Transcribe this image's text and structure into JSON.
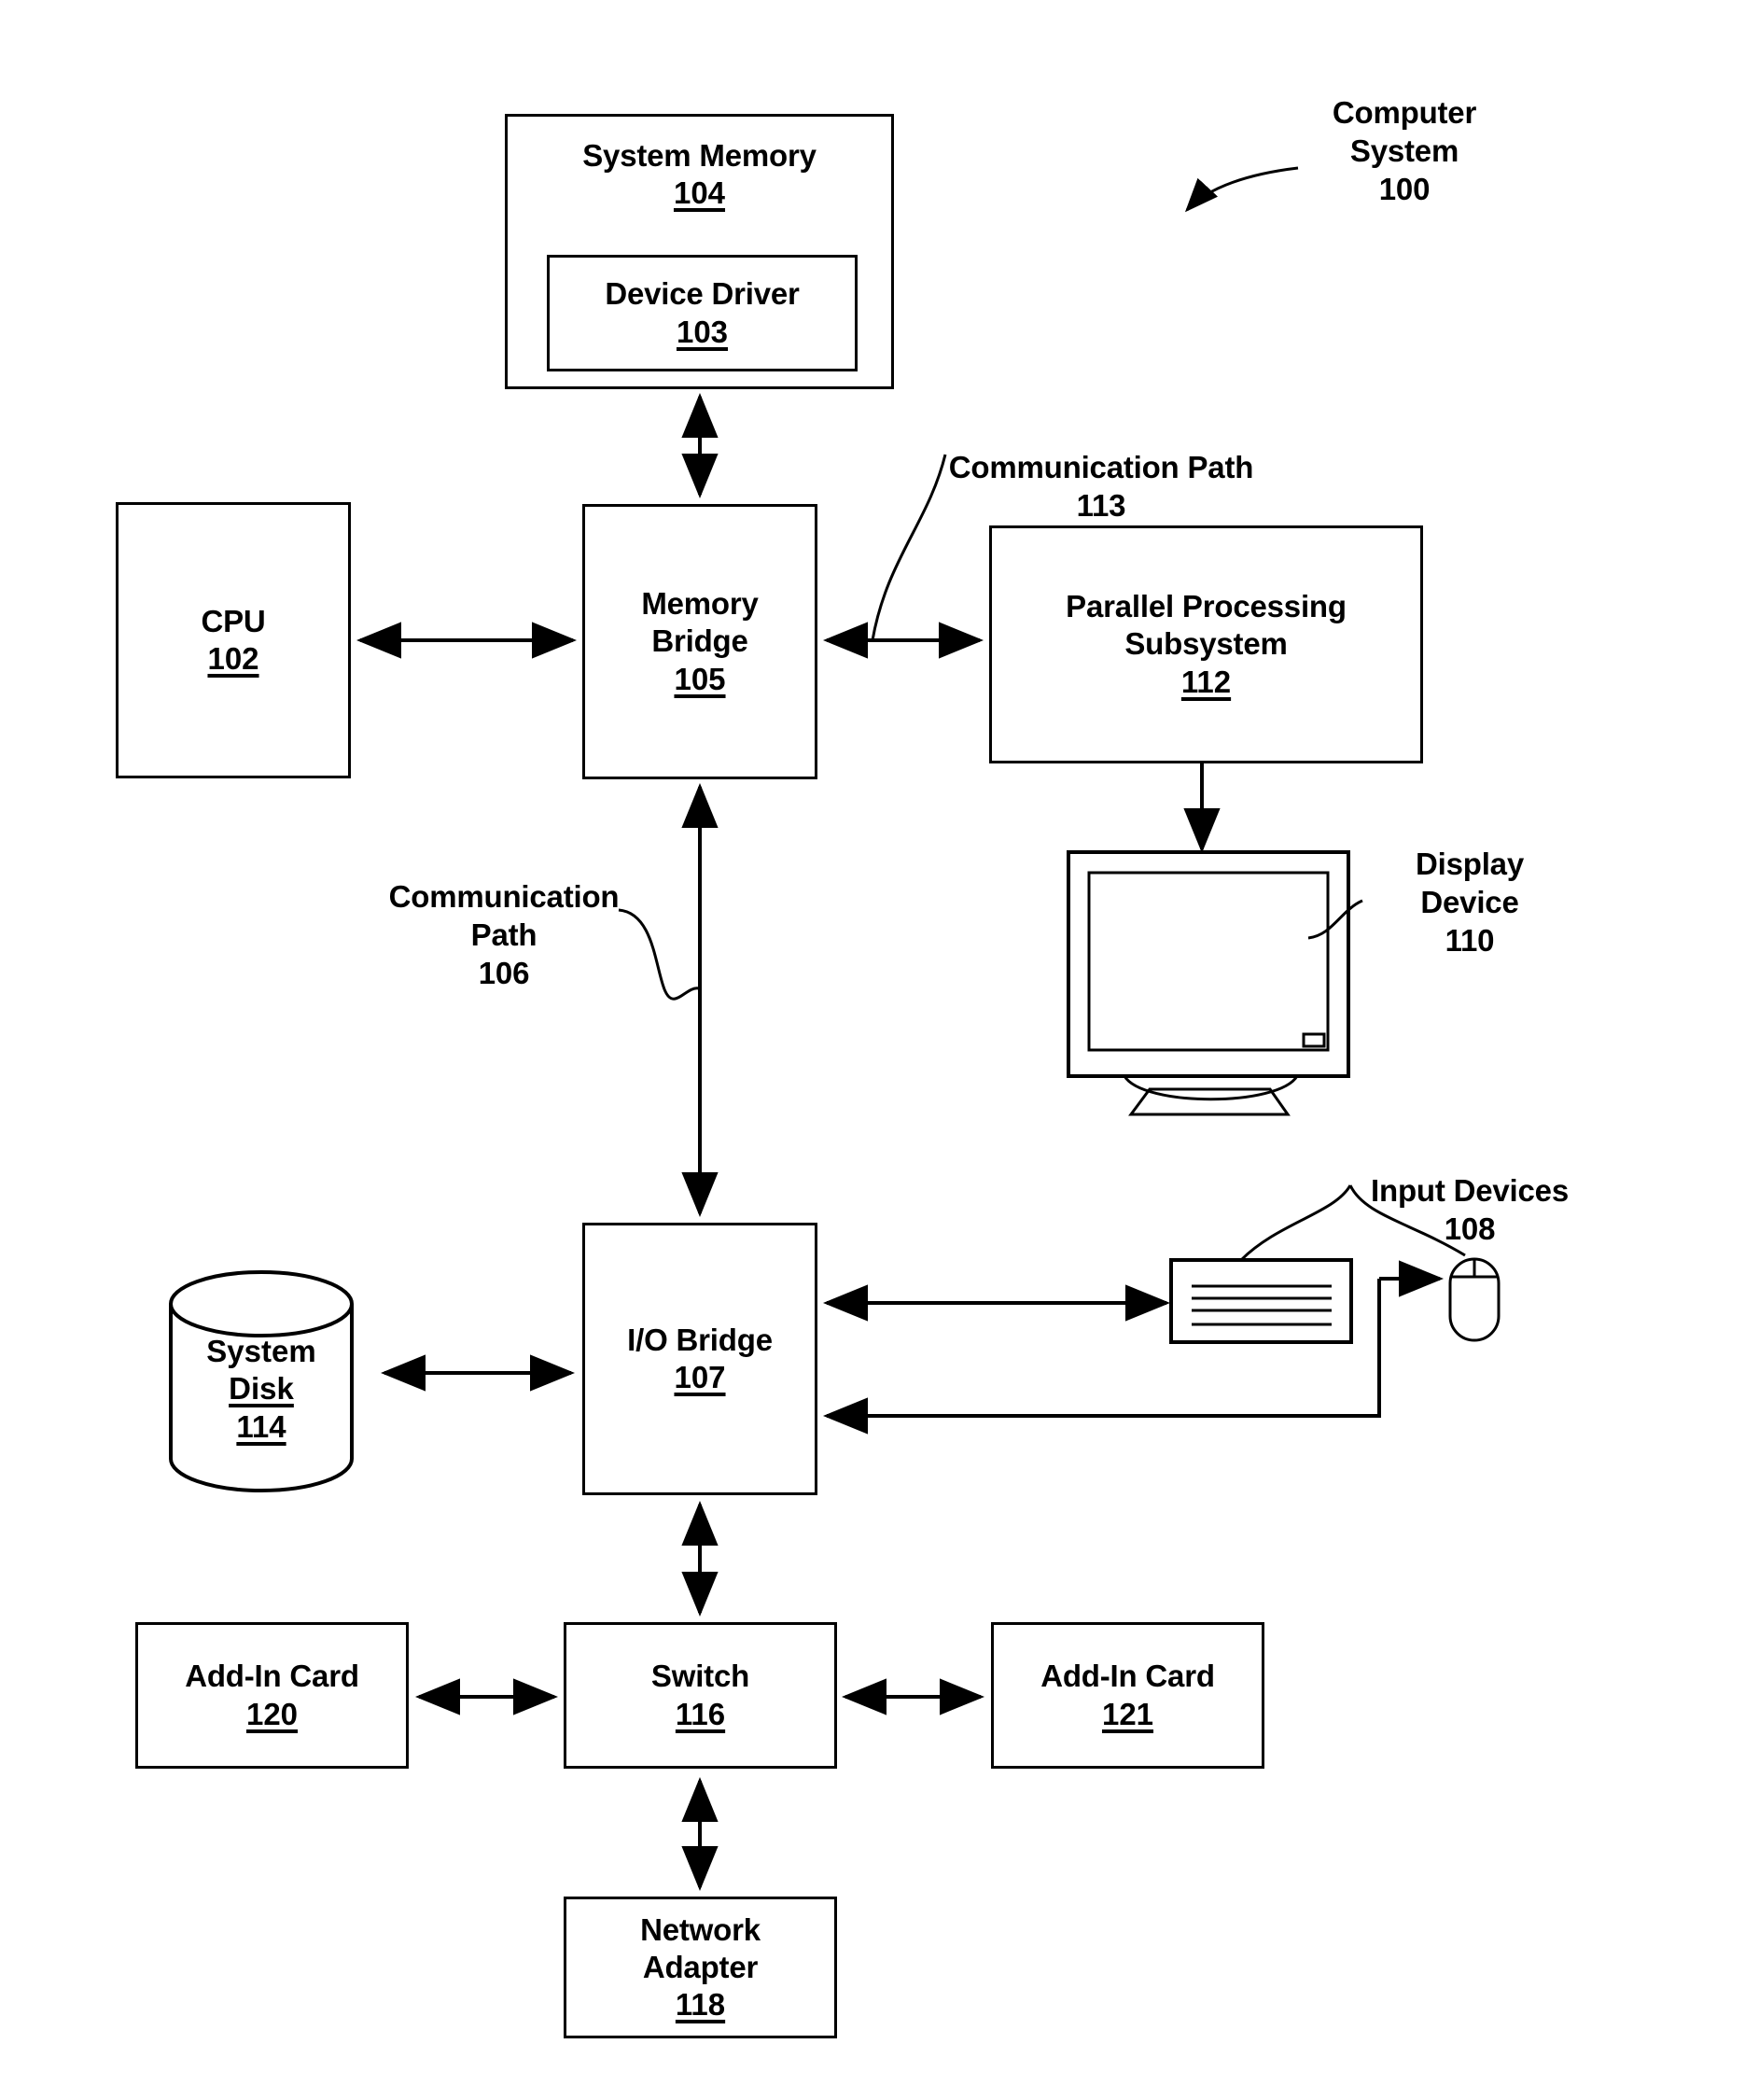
{
  "figure": {
    "title": "Computer System 100 block diagram"
  },
  "system_label": {
    "name": "Computer\nSystem",
    "number": "100"
  },
  "nodes": {
    "system_memory": {
      "title": "System Memory",
      "number": "104"
    },
    "device_driver": {
      "title": "Device Driver",
      "number": "103"
    },
    "cpu": {
      "title": "CPU",
      "number": "102"
    },
    "memory_bridge": {
      "title": "Memory\nBridge",
      "number": "105"
    },
    "parallel_processing_subsystem": {
      "title": "Parallel Processing\nSubsystem",
      "number": "112"
    },
    "io_bridge": {
      "title": "I/O Bridge",
      "number": "107"
    },
    "system_disk": {
      "line1": "System",
      "line2": "Disk",
      "number": "114"
    },
    "add_in_card_120": {
      "title": "Add-In Card",
      "number": "120"
    },
    "switch": {
      "title": "Switch",
      "number": "116"
    },
    "add_in_card_121": {
      "title": "Add-In Card",
      "number": "121"
    },
    "network_adapter": {
      "title": "Network\nAdapter",
      "number": "118"
    }
  },
  "captions": {
    "communication_path_113": {
      "name": "Communication Path",
      "number": "113"
    },
    "communication_path_106": {
      "name": "Communication\nPath",
      "number": "106"
    },
    "display_device_110": {
      "name": "Display\nDevice",
      "number": "110"
    },
    "input_devices_108": {
      "name": "Input Devices",
      "number": "108"
    }
  },
  "icons": {
    "display_device": "monitor-icon",
    "keyboard": "keyboard-icon",
    "mouse": "mouse-icon",
    "system_disk": "database-cylinder-icon"
  },
  "colors": {
    "stroke": "#000000",
    "fill": "#ffffff",
    "text": "#000000"
  },
  "connections": [
    {
      "from": "system_memory",
      "to": "memory_bridge",
      "style": "double-arrow",
      "orientation": "vertical"
    },
    {
      "from": "cpu",
      "to": "memory_bridge",
      "style": "double-arrow",
      "orientation": "horizontal"
    },
    {
      "from": "memory_bridge",
      "to": "parallel_processing_subsystem",
      "style": "double-arrow",
      "orientation": "horizontal",
      "label": "113"
    },
    {
      "from": "parallel_processing_subsystem",
      "to": "display_device",
      "style": "single-arrow",
      "orientation": "vertical"
    },
    {
      "from": "memory_bridge",
      "to": "io_bridge",
      "style": "double-arrow",
      "orientation": "vertical",
      "label": "106"
    },
    {
      "from": "system_disk",
      "to": "io_bridge",
      "style": "double-arrow",
      "orientation": "horizontal"
    },
    {
      "from": "io_bridge",
      "to": "keyboard",
      "style": "double-arrow",
      "orientation": "horizontal"
    },
    {
      "from": "mouse",
      "to": "io_bridge",
      "style": "single-arrow",
      "orientation": "elbow"
    },
    {
      "from": "io_bridge",
      "to": "switch",
      "style": "double-arrow",
      "orientation": "vertical"
    },
    {
      "from": "add_in_card_120",
      "to": "switch",
      "style": "double-arrow",
      "orientation": "horizontal"
    },
    {
      "from": "switch",
      "to": "add_in_card_121",
      "style": "double-arrow",
      "orientation": "horizontal"
    },
    {
      "from": "switch",
      "to": "network_adapter",
      "style": "double-arrow",
      "orientation": "vertical"
    }
  ]
}
